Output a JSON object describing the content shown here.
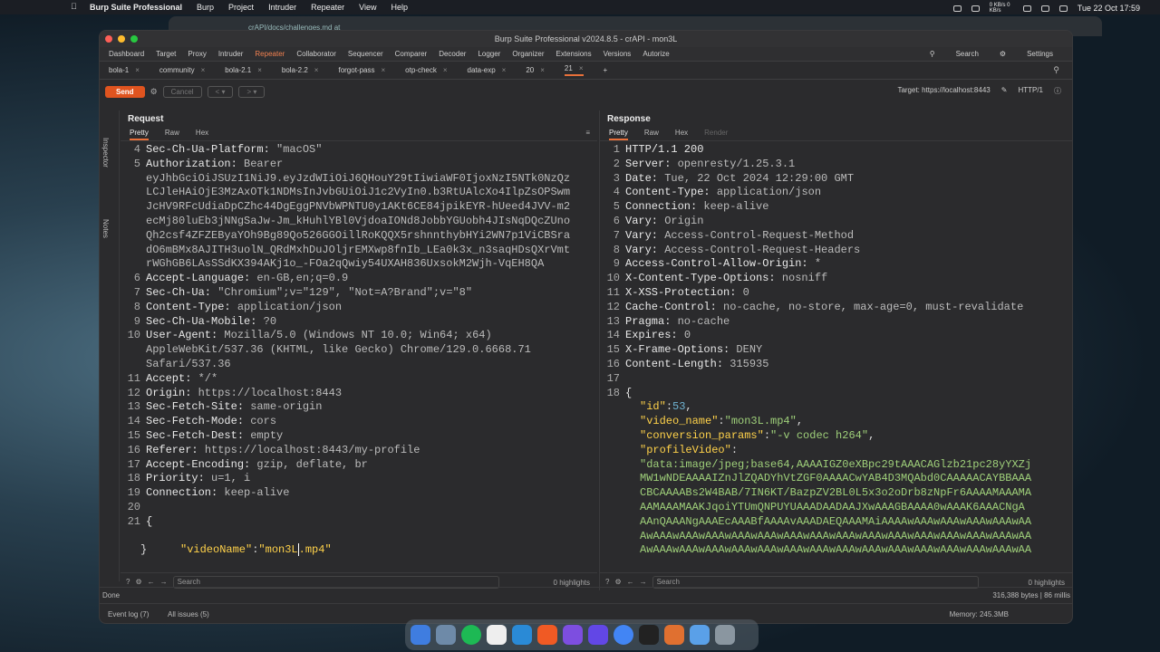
{
  "menubar": {
    "app": "Burp Suite Professional",
    "items": [
      "Burp",
      "Project",
      "Intruder",
      "Repeater",
      "View",
      "Help"
    ],
    "net": "0 KB/s 0 KB/s",
    "clock": "Tue 22 Oct 17:59"
  },
  "bgwin": {
    "tab": "crAPI/docs/challenges.md at"
  },
  "window": {
    "title": "Burp Suite Professional v2024.8.5 - crAPI - mon3L"
  },
  "topnav": {
    "items": [
      "Dashboard",
      "Target",
      "Proxy",
      "Intruder",
      "Repeater",
      "Collaborator",
      "Sequencer",
      "Comparer",
      "Decoder",
      "Logger",
      "Organizer",
      "Extensions",
      "Versions",
      "Autorize"
    ],
    "active": "Repeater",
    "search": "Search",
    "settings": "Settings"
  },
  "tabs": [
    "bola-1",
    "community",
    "bola-2.1",
    "bola-2.2",
    "forgot-pass",
    "otp-check",
    "data-exp",
    "20",
    "21"
  ],
  "toolbar": {
    "send": "Send",
    "cancel": "Cancel",
    "target": "Target: https://localhost:8443",
    "http": "HTTP/1"
  },
  "sidebar": {
    "inspector": "Inspector",
    "notes": "Notes"
  },
  "request": {
    "title": "Request",
    "tabs": [
      "Pretty",
      "Raw",
      "Hex"
    ],
    "lines": [
      {
        "n": "4",
        "k": "Sec-Ch-Ua-Platform: ",
        "v": "\"macOS\""
      },
      {
        "n": "5",
        "k": "Authorization: ",
        "v": "Bearer"
      },
      {
        "n": "",
        "k": "",
        "v": "eyJhbGciOiJSUzI1NiJ9.eyJzdWIiOiJ6QHouY29tIiwiaWF0IjoxNzI5NTk0NzQz"
      },
      {
        "n": "",
        "k": "",
        "v": "LCJleHAiOjE3MzAxOTk1NDMsInJvbGUiOiJ1c2VyIn0.b3RtUAlcXo4IlpZsOPSwm"
      },
      {
        "n": "",
        "k": "",
        "v": "JcHV9RFcUdiaDpCZhc44DgEggPNVbWPNTU0y1AKt6CE84jpikEYR-hUeed4JVV-m2"
      },
      {
        "n": "",
        "k": "",
        "v": "ecMj80luEb3jNNgSaJw-Jm_kHuhlYBl0VjdoaIONd8JobbYGUobh4JIsNqDQcZUno"
      },
      {
        "n": "",
        "k": "",
        "v": "Qh2csf4ZFZEByaYOh9Bg89Qo526GGOillRoKQQX5rshnnthybHYi2WN7p1ViCBSra"
      },
      {
        "n": "",
        "k": "",
        "v": "dO6mBMx8AJITH3uolN_QRdMxhDuJOljrEMXwp8fnIb_LEa0k3x_n3saqHDsQXrVmt"
      },
      {
        "n": "",
        "k": "",
        "v": "rWGhGB6LAsSSdKX394AKj1o_-FOa2qQwiy54UXAH836UxsokM2Wjh-VqEH8QA"
      },
      {
        "n": "6",
        "k": "Accept-Language: ",
        "v": "en-GB,en;q=0.9"
      },
      {
        "n": "7",
        "k": "Sec-Ch-Ua: ",
        "v": "\"Chromium\";v=\"129\", \"Not=A?Brand\";v=\"8\""
      },
      {
        "n": "8",
        "k": "Content-Type: ",
        "v": "application/json"
      },
      {
        "n": "9",
        "k": "Sec-Ch-Ua-Mobile: ",
        "v": "?0"
      },
      {
        "n": "10",
        "k": "User-Agent: ",
        "v": "Mozilla/5.0 (Windows NT 10.0; Win64; x64)"
      },
      {
        "n": "",
        "k": "",
        "v": "AppleWebKit/537.36 (KHTML, like Gecko) Chrome/129.0.6668.71"
      },
      {
        "n": "",
        "k": "",
        "v": "Safari/537.36"
      },
      {
        "n": "11",
        "k": "Accept: ",
        "v": "*/*"
      },
      {
        "n": "12",
        "k": "Origin: ",
        "v": "https://localhost:8443"
      },
      {
        "n": "13",
        "k": "Sec-Fetch-Site: ",
        "v": "same-origin"
      },
      {
        "n": "14",
        "k": "Sec-Fetch-Mode: ",
        "v": "cors"
      },
      {
        "n": "15",
        "k": "Sec-Fetch-Dest: ",
        "v": "empty"
      },
      {
        "n": "16",
        "k": "Referer: ",
        "v": "https://localhost:8443/my-profile"
      },
      {
        "n": "17",
        "k": "Accept-Encoding: ",
        "v": "gzip, deflate, br"
      },
      {
        "n": "18",
        "k": "Priority: ",
        "v": "u=1, i"
      },
      {
        "n": "19",
        "k": "Connection: ",
        "v": "keep-alive"
      },
      {
        "n": "20",
        "k": "",
        "v": ""
      },
      {
        "n": "21",
        "k": "{",
        "v": ""
      }
    ],
    "json_key": "\"videoName\"",
    "json_sep": ":",
    "json_val_a": "\"mon3L",
    "json_val_b": ".mp4\"",
    "close": "}",
    "search": "Search",
    "highlights": "0 highlights"
  },
  "response": {
    "title": "Response",
    "tabs": [
      "Pretty",
      "Raw",
      "Hex",
      "Render"
    ],
    "lines": [
      {
        "n": "1",
        "k": "HTTP/1.1 200",
        "v": ""
      },
      {
        "n": "2",
        "k": "Server: ",
        "v": "openresty/1.25.3.1"
      },
      {
        "n": "3",
        "k": "Date: ",
        "v": "Tue, 22 Oct 2024 12:29:00 GMT"
      },
      {
        "n": "4",
        "k": "Content-Type: ",
        "v": "application/json"
      },
      {
        "n": "5",
        "k": "Connection: ",
        "v": "keep-alive"
      },
      {
        "n": "6",
        "k": "Vary: ",
        "v": "Origin"
      },
      {
        "n": "7",
        "k": "Vary: ",
        "v": "Access-Control-Request-Method"
      },
      {
        "n": "8",
        "k": "Vary: ",
        "v": "Access-Control-Request-Headers"
      },
      {
        "n": "9",
        "k": "Access-Control-Allow-Origin: ",
        "v": "*"
      },
      {
        "n": "10",
        "k": "X-Content-Type-Options: ",
        "v": "nosniff"
      },
      {
        "n": "11",
        "k": "X-XSS-Protection: ",
        "v": "0"
      },
      {
        "n": "12",
        "k": "Cache-Control: ",
        "v": "no-cache, no-store, max-age=0, must-revalidate"
      },
      {
        "n": "13",
        "k": "Pragma: ",
        "v": "no-cache"
      },
      {
        "n": "14",
        "k": "Expires: ",
        "v": "0"
      },
      {
        "n": "15",
        "k": "X-Frame-Options: ",
        "v": "DENY"
      },
      {
        "n": "16",
        "k": "Content-Length: ",
        "v": "315935"
      },
      {
        "n": "17",
        "k": "",
        "v": ""
      },
      {
        "n": "18",
        "k": "{",
        "v": ""
      }
    ],
    "json": [
      {
        "k": "\"id\"",
        "v": "53",
        "t": "num"
      },
      {
        "k": "\"video_name\"",
        "v": "\"mon3L.mp4\"",
        "t": "str"
      },
      {
        "k": "\"conversion_params\"",
        "v": "\"-v codec h264\"",
        "t": "str"
      },
      {
        "k": "\"profileVideo\"",
        "v": "",
        "t": "str"
      }
    ],
    "b64": [
      "\"data:image/jpeg;base64,AAAAIGZ0eXBpc29tAAACAGlzb21pc28yYXZj",
      "MW1wNDEAAAAIZnJlZQADYhVtZGF0AAAACwYAB4D3MQAbd0CAAAAACAYBBAAA",
      "CBCAAAABs2W4BAB/7IN6KT/BazpZV2BL0L5x3o2oDrb8zNpFr6AAAAMAAAMA",
      "AAMAAAMAAKJqoiYTUmQNPUYUAAADAADAAJXwAAAGBAAAA0wAAAK6AAACNgA",
      "AAnQAAANgAAAEcAAABfAAAAvAAADAEQAAAMAiAAAAwAAAwAAAwAAAwAAAwAA",
      "AwAAAwAAAwAAAwAAAwAAAwAAAwAAAwAAAwAAAwAAAwAAAwAAAwAAAwAAAwAA",
      "AwAAAwAAAwAAAwAAAwAAAwAAAwAAAwAAAwAAAwAAAwAAAwAAAwAAAwAAAwAA"
    ],
    "search": "Search",
    "highlights": "0 highlights"
  },
  "status": {
    "left": "Done",
    "right": "316,388 bytes | 86 millis"
  },
  "bottom": {
    "eventlog": "Event log (7)",
    "issues": "All issues (5)",
    "memory": "Memory: 245.3MB"
  }
}
